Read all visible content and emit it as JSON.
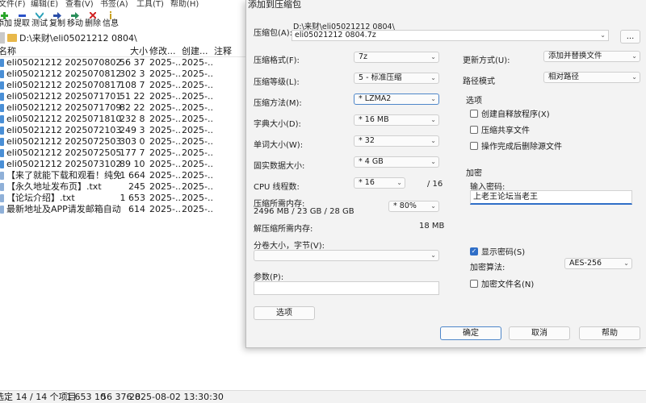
{
  "main": {
    "menu": [
      "文件(F)",
      "编辑(E)",
      "查看(V)",
      "书签(A)",
      "工具(T)",
      "帮助(H)"
    ],
    "toolbar": [
      "添加",
      "提取",
      "测试",
      "复制",
      "移动",
      "删除",
      "信息"
    ],
    "path": "D:\\来财\\eli05021212 0804\\",
    "columns": {
      "name": "名称",
      "size": "大小",
      "modified": "修改...",
      "created": "创建...",
      "comment": "注释"
    },
    "files": [
      {
        "name": "eli05021212 2025070802.w...",
        "size": "56 37...",
        "modified": "2025-...",
        "created": "2025-...",
        "type": "arch"
      },
      {
        "name": "eli05021212 2025070812.w...",
        "size": "302 3...",
        "modified": "2025-...",
        "created": "2025-...",
        "type": "arch"
      },
      {
        "name": "eli05021212 2025070817.w...",
        "size": "108 7...",
        "modified": "2025-...",
        "created": "2025-...",
        "type": "arch"
      },
      {
        "name": "eli05021212 2025071701.w...",
        "size": "51 22...",
        "modified": "2025-...",
        "created": "2025-...",
        "type": "arch"
      },
      {
        "name": "eli05021212 2025071709.w...",
        "size": "82 22...",
        "modified": "2025-...",
        "created": "2025-...",
        "type": "arch"
      },
      {
        "name": "eli05021212 2025071810.w...",
        "size": "232 8...",
        "modified": "2025-...",
        "created": "2025-...",
        "type": "arch"
      },
      {
        "name": "eli05021212 2025072103.w...",
        "size": "249 3...",
        "modified": "2025-...",
        "created": "2025-...",
        "type": "arch"
      },
      {
        "name": "eli05021212 2025072503.w...",
        "size": "303 0...",
        "modified": "2025-...",
        "created": "2025-...",
        "type": "arch"
      },
      {
        "name": "eli05021212 2025072505.w...",
        "size": "177 7...",
        "modified": "2025-...",
        "created": "2025-...",
        "type": "arch"
      },
      {
        "name": "eli05021212 2025073102.w...",
        "size": "89 10...",
        "modified": "2025-...",
        "created": "2025-...",
        "type": "arch"
      },
      {
        "name": "【来了就能下载和观看！纯免...",
        "size": "1 664",
        "modified": "2025-...",
        "created": "2025-...",
        "type": "txt"
      },
      {
        "name": "【永久地址发布页】.txt",
        "size": "245",
        "modified": "2025-...",
        "created": "2025-...",
        "type": "txt"
      },
      {
        "name": "【论坛介绍】.txt",
        "size": "1 653",
        "modified": "2025-...",
        "created": "2025-...",
        "type": "txt"
      },
      {
        "name": "最新地址及APP请发邮箱自动...",
        "size": "614",
        "modified": "2025-...",
        "created": "2025-...",
        "type": "txt"
      }
    ],
    "status": {
      "selected": "选定 14 / 14 个项目",
      "size": "1 653 10",
      "size2": "56 376 8",
      "date": "2025-08-02 13:30:30"
    }
  },
  "dialog": {
    "title": "添加到压缩包",
    "archive_label": "压缩包(A):",
    "archive_dir": "D:\\来财\\eli05021212 0804\\",
    "archive_name": "eli05021212 0804.7z",
    "browse": "...",
    "format_label": "压缩格式(F):",
    "format": "7z",
    "level_label": "压缩等级(L):",
    "level": "5 - 标准压缩",
    "method_label": "压缩方法(M):",
    "method": "*  LZMA2",
    "dict_label": "字典大小(D):",
    "dict": "*  16 MB",
    "word_label": "单词大小(W):",
    "word": "*  32",
    "solid_label": "固实数据大小:",
    "solid": "*  4 GB",
    "cpu_label": "CPU 线程数:",
    "cpu": "*  16",
    "cpu_total": "/ 16",
    "mem_label": "压缩所需内存:",
    "mem_value": "2496 MB / 23 GB / 28 GB",
    "mem_pct": "* 80%",
    "decomp_label": "解压缩所需内存:",
    "decomp_value": "18 MB",
    "split_label": "分卷大小，字节(V):",
    "split": "",
    "params_label": "参数(P):",
    "params": "",
    "options_btn": "选项",
    "update_label": "更新方式(U):",
    "update": "添加并替换文件",
    "pathmode_label": "路径模式",
    "pathmode": "相对路径",
    "options_group": "选项",
    "opt_sfx": "创建自释放程序(X)",
    "opt_shared": "压缩共享文件",
    "opt_delete": "操作完成后删除源文件",
    "enc_group": "加密",
    "pw_label": "输入密码:",
    "pw_value": "上老王论坛当老王",
    "show_pw": "显示密码(S)",
    "algo_label": "加密算法:",
    "algo": "AES-256",
    "enc_names": "加密文件名(N)",
    "ok": "确定",
    "cancel": "取消",
    "help": "帮助"
  },
  "colors": {
    "accent": "#2f6ec7",
    "folder": "#e8b84a",
    "archive_icon": "#4a8fd6"
  }
}
